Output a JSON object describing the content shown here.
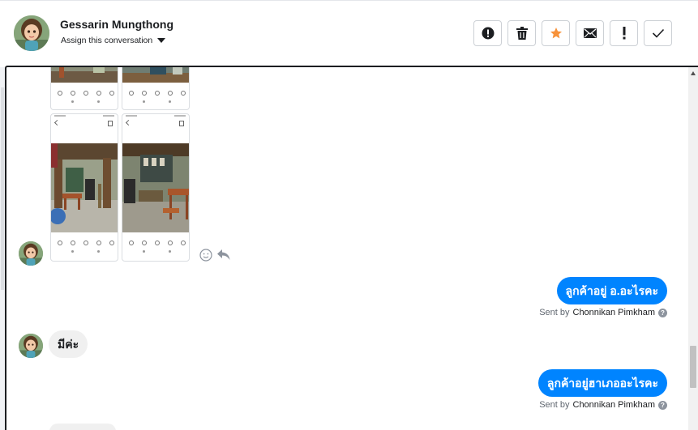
{
  "header": {
    "contact_name": "Gessarin Mungthong",
    "assign_label": "Assign this conversation",
    "actions": [
      {
        "name": "mark-spam-button",
        "icon": "alert-circle-icon"
      },
      {
        "name": "delete-button",
        "icon": "trash-icon"
      },
      {
        "name": "star-button",
        "icon": "star-icon",
        "color": "#f7923a"
      },
      {
        "name": "mark-unread-button",
        "icon": "envelope-icon"
      },
      {
        "name": "follow-up-button",
        "icon": "exclamation-icon"
      },
      {
        "name": "mark-done-button",
        "icon": "check-icon"
      }
    ]
  },
  "colors": {
    "accent": "#0084ff",
    "incoming_bubble": "#f0f0f0",
    "star": "#f7923a"
  },
  "conversation": {
    "messages": [
      {
        "direction": "outgoing",
        "text": "ลูกค้าอยู่ อ.อะไรคะ",
        "sent_by_prefix": "Sent by",
        "sent_by_name": "Chonnikan Pimkham"
      },
      {
        "direction": "incoming",
        "text": "มีค่ะ"
      },
      {
        "direction": "outgoing",
        "text": "ลูกค้าอยู่ฮาเภออะไรคะ",
        "sent_by_prefix": "Sent by",
        "sent_by_name": "Chonnikan Pimkham"
      }
    ]
  }
}
